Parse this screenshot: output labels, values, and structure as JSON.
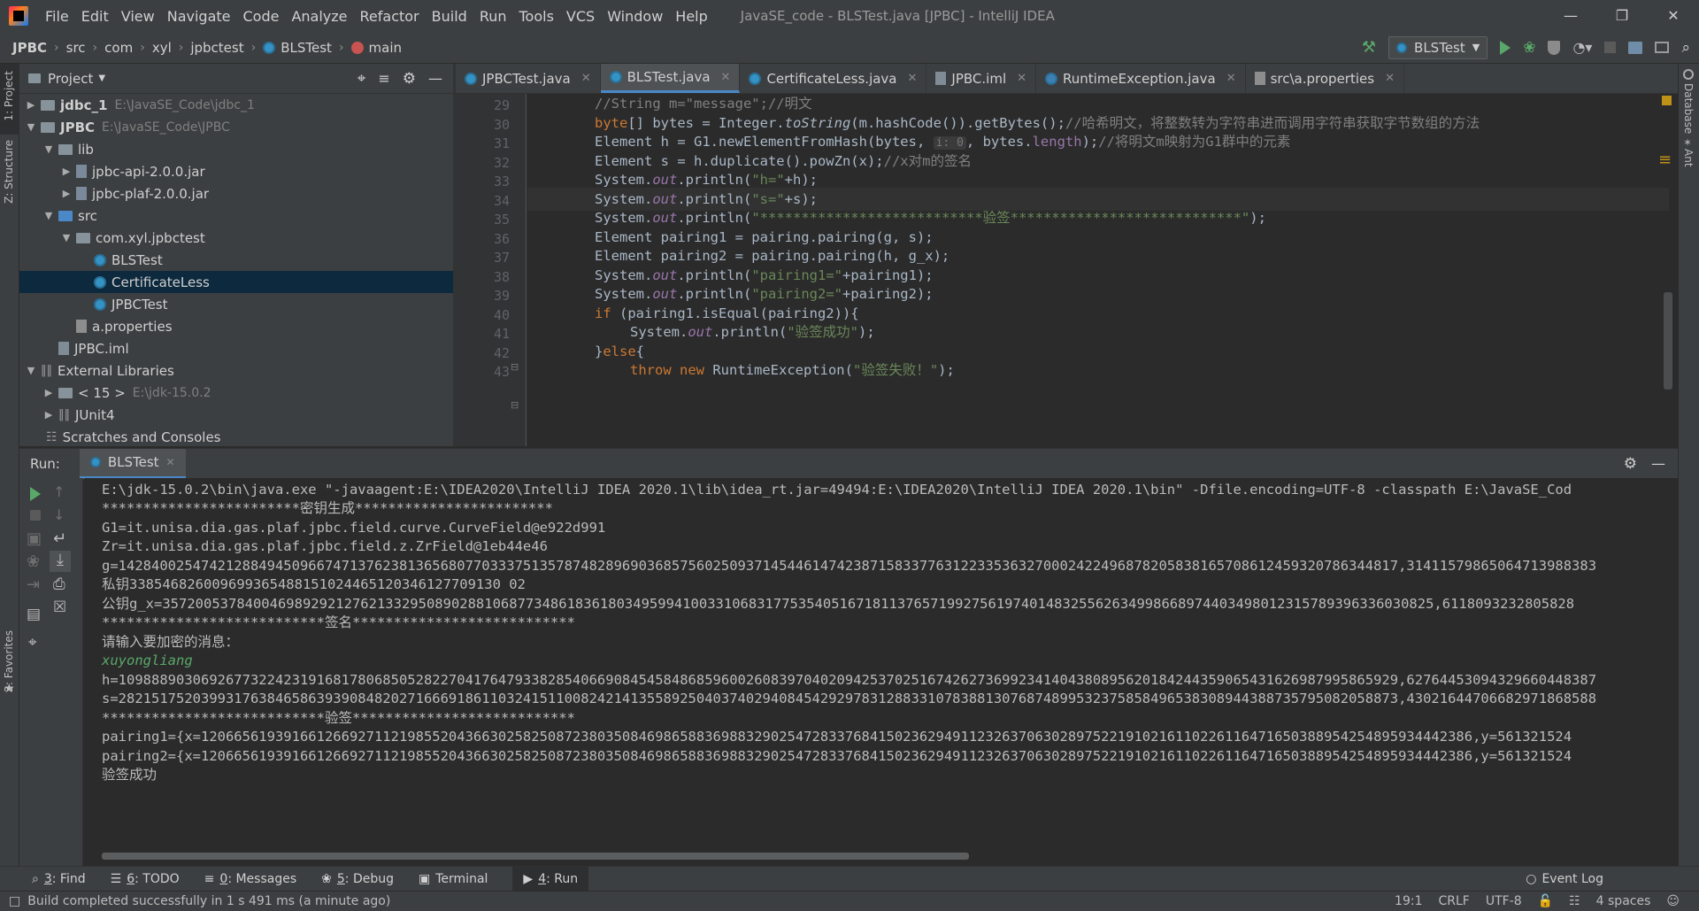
{
  "menu": {
    "items": [
      "File",
      "Edit",
      "View",
      "Navigate",
      "Code",
      "Analyze",
      "Refactor",
      "Build",
      "Run",
      "Tools",
      "VCS",
      "Window",
      "Help"
    ],
    "title": "JavaSE_code - BLSTest.java [JPBC] - IntelliJ IDEA"
  },
  "breadcrumb": [
    "JPBC",
    "src",
    "com",
    "xyl",
    "jpbctest",
    "BLSTest",
    "main"
  ],
  "run_config": "BLSTest",
  "left_tabs": {
    "project": "1: Project",
    "structure": "Z: Structure",
    "favorites": "2: Favorites"
  },
  "right_tabs": {
    "database": "Database",
    "ant": "Ant"
  },
  "project_panel": {
    "title": "Project",
    "tree": [
      {
        "label": "jdbc_1",
        "path": "E:\\JavaSE_Code\\jdbc_1",
        "bold": true
      },
      {
        "label": "JPBC",
        "path": "E:\\JavaSE_Code\\JPBC",
        "bold": true
      },
      {
        "label": "lib"
      },
      {
        "label": "jpbc-api-2.0.0.jar"
      },
      {
        "label": "jpbc-plaf-2.0.0.jar"
      },
      {
        "label": "src"
      },
      {
        "label": "com.xyl.jpbctest"
      },
      {
        "label": "BLSTest"
      },
      {
        "label": "CertificateLess"
      },
      {
        "label": "JPBCTest"
      },
      {
        "label": "a.properties"
      },
      {
        "label": "JPBC.iml"
      },
      {
        "label": "External Libraries"
      },
      {
        "label": "< 15 >",
        "path": "E:\\jdk-15.0.2"
      },
      {
        "label": "JUnit4"
      },
      {
        "label": "Scratches and Consoles"
      }
    ]
  },
  "editor_tabs": [
    "JPBCTest.java",
    "BLSTest.java",
    "CertificateLess.java",
    "JPBC.iml",
    "RuntimeException.java",
    "src\\a.properties"
  ],
  "line_numbers": [
    "29",
    "30",
    "31",
    "32",
    "33",
    "34",
    "35",
    "36",
    "37",
    "38",
    "39",
    "40",
    "41",
    "42",
    "43"
  ],
  "code": {
    "l29": "//String m=\"message\";//明文",
    "l30a": "byte",
    "l30b": "[] bytes = Integer.",
    "l30c": "toString",
    "l30d": "(m.hashCode()).getBytes();",
    "l30e": "//哈希明文，将整数转为字符串进而调用字符串获取字节数组的方法",
    "l31a": "Element h = G1.newElementFromHash(bytes, ",
    "l31hint": "i: 0",
    "l31b": ", bytes.",
    "l31c": "length",
    "l31d": ");",
    "l31e": "//将明文m映射为G1群中的元素",
    "l32a": "Element s = h.duplicate().powZn(x);",
    "l32b": "//x对m的签名",
    "sys": "System.",
    "out": "out",
    "l33a": ".println(",
    "l33s": "\"h=\"",
    "l33b": "+h);",
    "l34s": "\"s=\"",
    "l34b": "+s);",
    "l35s": "\"***************************验签****************************\"",
    "l35b": ");",
    "l36": "Element pairing1 = pairing.pairing(g, s);",
    "l37": "Element pairing2 = pairing.pairing(h, g_x);",
    "l38s": "\"pairing1=\"",
    "l38b": "+pairing1);",
    "l39s": "\"pairing2=\"",
    "l39b": "+pairing2);",
    "l40a": "if",
    "l40b": " (pairing1.isEqual(pairing2)){",
    "l41s": "\"验签成功\"",
    "l41b": ");",
    "l42a": "}",
    "l42b": "else",
    "l42c": "{",
    "l43a": "throw new",
    "l43b": " RuntimeException(",
    "l43s": "\"验签失败！\"",
    "l43c": ");"
  },
  "run_panel": {
    "label": "Run:",
    "tab": "BLSTest"
  },
  "console": [
    "E:\\jdk-15.0.2\\bin\\java.exe \"-javaagent:E:\\IDEA2020\\IntelliJ IDEA 2020.1\\lib\\idea_rt.jar=49494:E:\\IDEA2020\\IntelliJ IDEA 2020.1\\bin\" -Dfile.encoding=UTF-8 -classpath E:\\JavaSE_Cod",
    "************************密钥生成************************",
    "G1=it.unisa.dia.gas.plaf.jpbc.field.curve.CurveField@e922d991",
    "Zr=it.unisa.dia.gas.plaf.jpbc.field.z.ZrField@1eb44e46",
    "g=14284002547421288494509667471376238136568077033375135787482896903685756025093714544614742387158337763122335363270002422496878205838165708612459320786344817,31411579865064713988383",
    "私钥338546826009699365488151024465120346127709130 02",
    "公钥g_x=3572005378400469892921276213329508902881068773486183618034959941003310683177535405167181137657199275619740148325562634998668974403498012315789396336030825,6118093232805828",
    "***************************签名***************************",
    "请输入要加密的消息：",
    "xuyongliang",
    "h=10988890306926773224231916817806850528227041764793382854066908454584868596002608397040209425370251674262736992341404380895620184244359065431626987995865929,62764453094329660448387",
    "s=28215175203993176384658639390848202716669186110324151100824214135589250403740294084542929783128833107838813076874899532375858496538308944388735795082058873,43021644706682971868588",
    "***************************验签***************************",
    "pairing1={x=1206656193916612669271121985520436630258250872380350846986588369883290254728337684150236294911232637063028975221910216110226116471650388954254895934442386,y=561321524",
    "pairing2={x=1206656193916612669271121985520436630258250872380350846986588369883290254728337684150236294911232637063028975221910216110226116471650388954254895934442386,y=561321524",
    "验签成功"
  ],
  "bottom_tabs": [
    {
      "num": "3",
      "label": ": Find"
    },
    {
      "num": "6",
      "label": ": TODO"
    },
    {
      "num": "0",
      "label": ": Messages"
    },
    {
      "num": "5",
      "label": ": Debug"
    },
    {
      "num": "",
      "label": "Terminal"
    },
    {
      "num": "4",
      "label": ": Run"
    }
  ],
  "event_log": "Event Log",
  "status": {
    "message": "Build completed successfully in 1 s 491 ms (a minute ago)",
    "position": "19:1",
    "line_sep": "CRLF",
    "encoding": "UTF-8",
    "indent": "4 spaces"
  },
  "colors": {
    "accent": "#4a88c7",
    "run_green": "#59a869",
    "keyword": "#cc7832",
    "string": "#6a8759",
    "comment": "#808080",
    "field": "#9876aa"
  }
}
